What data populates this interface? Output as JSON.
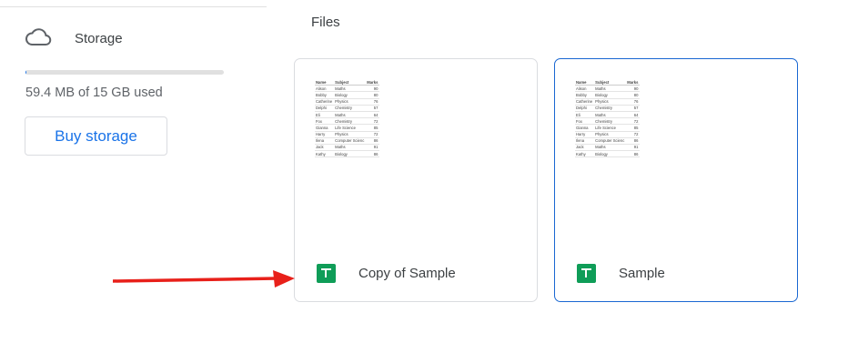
{
  "sidebar": {
    "storage_label": "Storage",
    "quota_text": "59.4 MB of 15 GB used",
    "quota_fraction": 0.004,
    "buy_label": "Buy storage"
  },
  "main": {
    "section_title": "Files",
    "files": [
      {
        "name": "Copy of Sample",
        "selected": false
      },
      {
        "name": "Sample",
        "selected": true
      }
    ],
    "preview_table": {
      "headers": [
        "Name",
        "Subject",
        "Marks"
      ],
      "rows": [
        [
          "Alison",
          "Maths",
          "90"
        ],
        [
          "Bobby",
          "Biology",
          "80"
        ],
        [
          "Catherine",
          "Physics",
          "76"
        ],
        [
          "Delphi",
          "Chemistry",
          "57"
        ],
        [
          "Eli",
          "Maths",
          "64"
        ],
        [
          "Fox",
          "Chemistry",
          "72"
        ],
        [
          "Gianna",
          "Life Science",
          "85"
        ],
        [
          "Harry",
          "Physics",
          "72"
        ],
        [
          "Ilena",
          "Computer Scienc",
          "86"
        ],
        [
          "Jack",
          "Maths",
          "91"
        ],
        [
          "Kathy",
          "Biology",
          "86"
        ]
      ]
    }
  },
  "colors": {
    "accent": "#1a73e8",
    "sheets_green": "#0f9d58",
    "annotation_arrow": "#e8201a"
  },
  "icons": {
    "storage": "cloud-icon",
    "file_type": "google-sheets-icon"
  }
}
